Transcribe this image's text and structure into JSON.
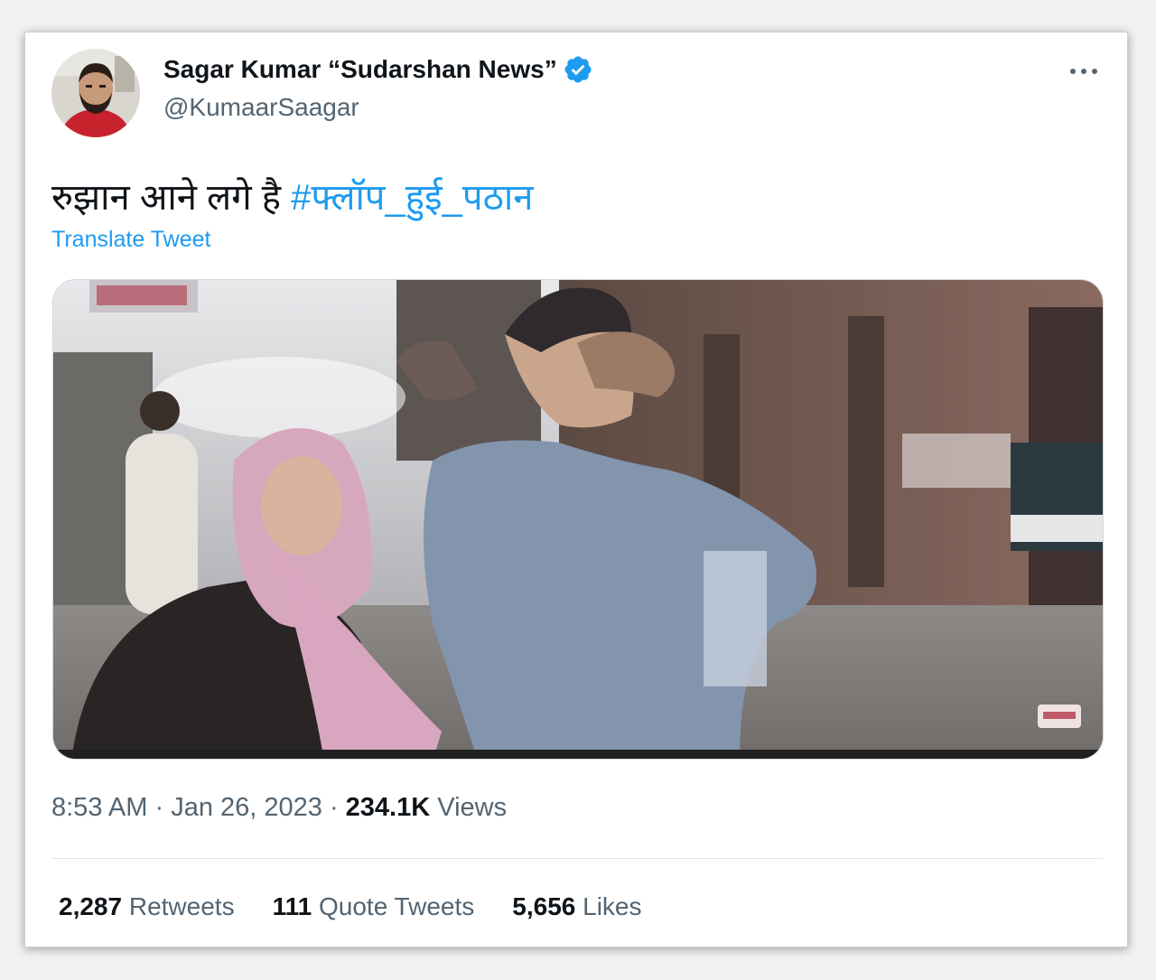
{
  "author": {
    "name": "Sagar Kumar “Sudarshan News”",
    "handle": "@KumaarSaagar",
    "verified": true,
    "verified_color": "#1d9bf0"
  },
  "icons": {
    "verified": "verified-badge-icon",
    "more": "more-options-icon"
  },
  "tweet": {
    "text": "रुझान आने लगे है",
    "hashtag": "#फ्लॉप_हुई_पठान",
    "translate_label": "Translate Tweet"
  },
  "meta": {
    "time": "8:53 AM",
    "date": "Jan 26, 2023",
    "views_count": "234.1K",
    "views_label": "Views"
  },
  "stats": {
    "retweets_count": "2,287",
    "retweets_label": "Retweets",
    "quotes_count": "111",
    "quotes_label": "Quote Tweets",
    "likes_count": "5,656",
    "likes_label": "Likes"
  },
  "colors": {
    "link": "#1d9bf0",
    "text_primary": "#0f1419",
    "text_secondary": "#536471"
  }
}
